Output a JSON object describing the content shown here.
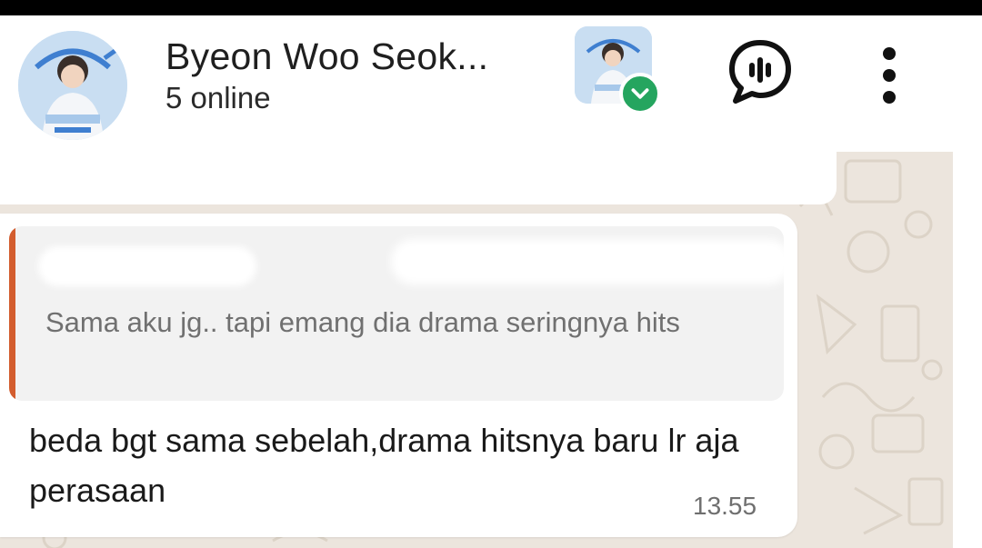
{
  "header": {
    "title": "Byeon Woo Seok...",
    "subtitle": "5 online",
    "group_avatar_icon": "group-avatar-photo",
    "community_avatar_icon": "community-avatar-photo",
    "verified_icon": "check-badge-icon",
    "voice_chat_icon": "voice-chat-icon",
    "menu_icon": "more-vertical-icon"
  },
  "chat": {
    "message": {
      "quoted_text": "Sama aku jg.. tapi emang dia drama seringnya hits",
      "text": "beda bgt sama sebelah,drama hitsnya baru lr aja perasaan",
      "time": "13.55"
    }
  },
  "colors": {
    "quote_bar": "#d35d2e",
    "verified_badge": "#25a55f",
    "chat_background": "#ece5dd"
  }
}
